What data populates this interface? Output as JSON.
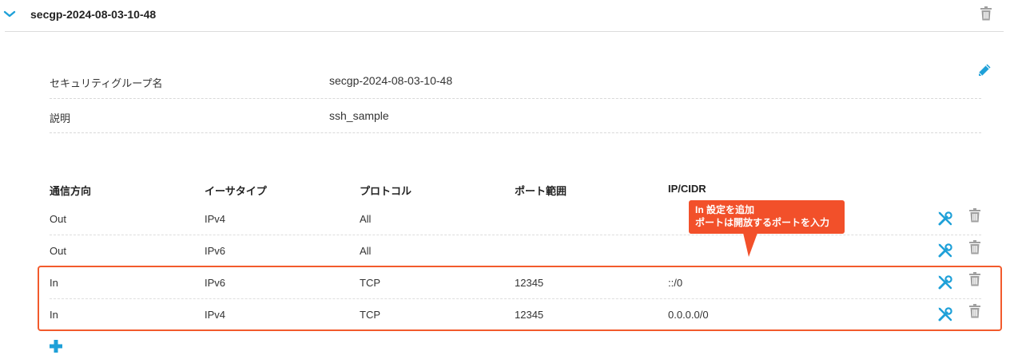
{
  "group": {
    "title": "secgp-2024-08-03-10-48",
    "icons": {
      "toggle": "chevron-down-icon",
      "delete": "trash-icon",
      "edit": "pencil-icon"
    }
  },
  "info": {
    "name_label": "セキュリティグループ名",
    "name_value": "secgp-2024-08-03-10-48",
    "desc_label": "説明",
    "desc_value": "ssh_sample"
  },
  "rules": {
    "headers": [
      "通信方向",
      "イーサタイプ",
      "プロトコル",
      "ポート範囲",
      "IP/CIDR"
    ],
    "rows": [
      {
        "direction": "Out",
        "ethertype": "IPv4",
        "protocol": "All",
        "port": "",
        "cidr": ""
      },
      {
        "direction": "Out",
        "ethertype": "IPv6",
        "protocol": "All",
        "port": "",
        "cidr": ""
      },
      {
        "direction": "In",
        "ethertype": "IPv6",
        "protocol": "TCP",
        "port": "12345",
        "cidr": "::/0"
      },
      {
        "direction": "In",
        "ethertype": "IPv4",
        "protocol": "TCP",
        "port": "12345",
        "cidr": "0.0.0.0/0"
      }
    ],
    "row_icons": {
      "edit": "wrench-screwdriver-icon",
      "delete": "trash-icon"
    },
    "add_icon": "plus-icon"
  },
  "callout": {
    "line1": "In 設定を追加",
    "line2": "ポートは開放するポートを入力"
  },
  "colors": {
    "accent": "#1ea0d8",
    "highlight": "#f2502a",
    "icon_gray": "#a0a0a0"
  }
}
